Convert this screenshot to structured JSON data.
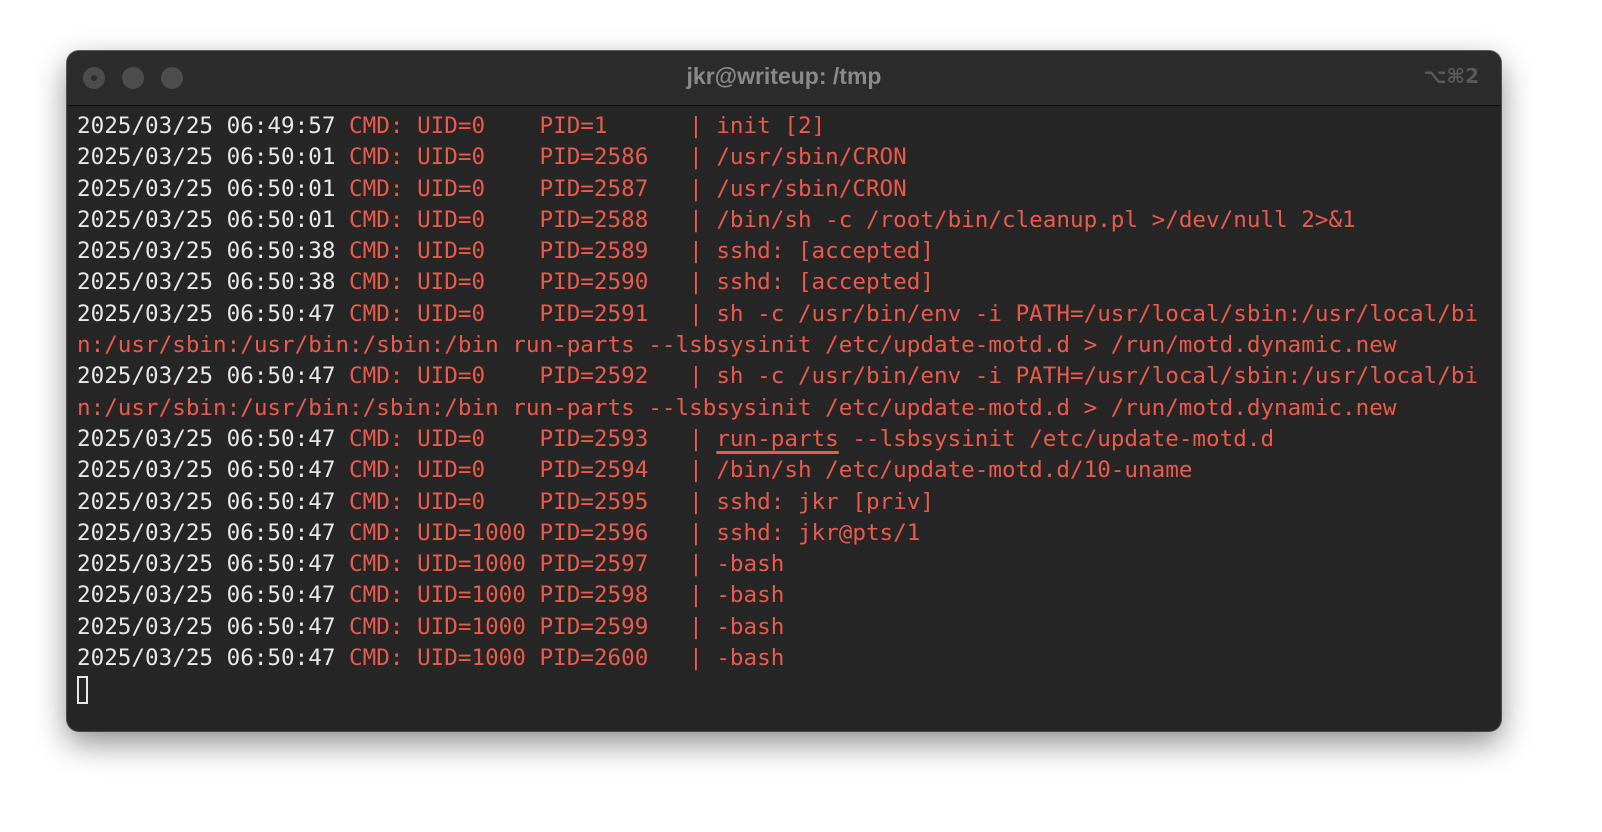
{
  "window": {
    "title": "jkr@writeup: /tmp",
    "shortcut": "⌥⌘2"
  },
  "colors": {
    "background": "#262626",
    "timestamp": "#e8e8e8",
    "output": "#ec5a4c"
  },
  "icons": [
    "close-button-icon",
    "minimize-button-icon",
    "zoom-button-icon"
  ],
  "terminal": {
    "lines": [
      {
        "ts": "2025/03/25 06:49:57",
        "text": " CMD: UID=0    PID=1      | init [2]"
      },
      {
        "ts": "2025/03/25 06:50:01",
        "text": " CMD: UID=0    PID=2586   | /usr/sbin/CRON"
      },
      {
        "ts": "2025/03/25 06:50:01",
        "text": " CMD: UID=0    PID=2587   | /usr/sbin/CRON"
      },
      {
        "ts": "2025/03/25 06:50:01",
        "text": " CMD: UID=0    PID=2588   | /bin/sh -c /root/bin/cleanup.pl >/dev/null 2>&1"
      },
      {
        "ts": "2025/03/25 06:50:38",
        "text": " CMD: UID=0    PID=2589   | sshd: [accepted]"
      },
      {
        "ts": "2025/03/25 06:50:38",
        "text": " CMD: UID=0    PID=2590   | sshd: [accepted]"
      },
      {
        "ts": "2025/03/25 06:50:47",
        "text": " CMD: UID=0    PID=2591   | sh -c /usr/bin/env -i PATH=/usr/local/sbin:/usr/local/bi"
      },
      {
        "ts": "",
        "text": "n:/usr/sbin:/usr/bin:/sbin:/bin run-parts --lsbsysinit /etc/update-motd.d > /run/motd.dynamic.new"
      },
      {
        "ts": "2025/03/25 06:50:47",
        "text": " CMD: UID=0    PID=2592   | sh -c /usr/bin/env -i PATH=/usr/local/sbin:/usr/local/bi"
      },
      {
        "ts": "",
        "text": "n:/usr/sbin:/usr/bin:/sbin:/bin run-parts --lsbsysinit /etc/update-motd.d > /run/motd.dynamic.new"
      },
      {
        "ts": "2025/03/25 06:50:47",
        "text": " CMD: UID=0    PID=2593   | ",
        "underlined": "run-parts",
        "after": " --lsbsysinit /etc/update-motd.d"
      },
      {
        "ts": "2025/03/25 06:50:47",
        "text": " CMD: UID=0    PID=2594   | /bin/sh /etc/update-motd.d/10-uname"
      },
      {
        "ts": "2025/03/25 06:50:47",
        "text": " CMD: UID=0    PID=2595   | sshd: jkr [priv]"
      },
      {
        "ts": "2025/03/25 06:50:47",
        "text": " CMD: UID=1000 PID=2596   | sshd: jkr@pts/1"
      },
      {
        "ts": "2025/03/25 06:50:47",
        "text": " CMD: UID=1000 PID=2597   | -bash"
      },
      {
        "ts": "2025/03/25 06:50:47",
        "text": " CMD: UID=1000 PID=2598   | -bash"
      },
      {
        "ts": "2025/03/25 06:50:47",
        "text": " CMD: UID=1000 PID=2599   | -bash"
      },
      {
        "ts": "2025/03/25 06:50:47",
        "text": " CMD: UID=1000 PID=2600   | -bash"
      }
    ]
  }
}
